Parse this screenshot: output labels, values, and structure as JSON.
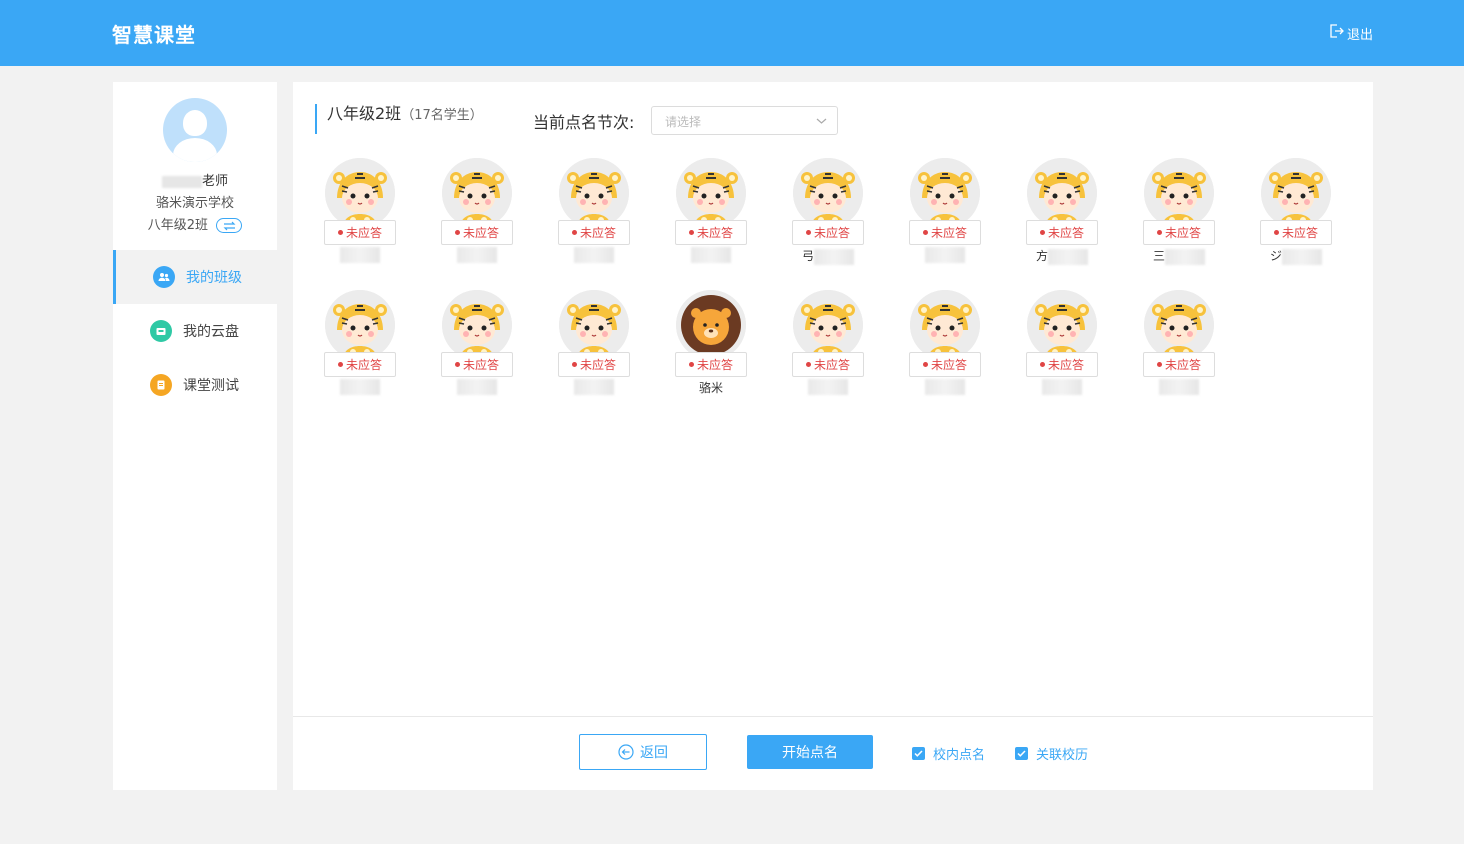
{
  "header": {
    "app_title": "智慧课堂",
    "logout_label": "退出"
  },
  "sidebar": {
    "teacher_suffix": "老师",
    "school": "骆米演示学校",
    "class_name": "八年级2班",
    "items": [
      {
        "label": "我的班级",
        "icon": "users-icon",
        "active": true,
        "color": "#3aa7f5"
      },
      {
        "label": "我的云盘",
        "icon": "cloud-drive-icon",
        "active": false,
        "color": "#2fc9a5"
      },
      {
        "label": "课堂测试",
        "icon": "test-doc-icon",
        "active": false,
        "color": "#f5a623"
      }
    ]
  },
  "main": {
    "class_title": "八年级2班",
    "student_count": "（17名学生）",
    "session_label": "当前点名节次:",
    "session_placeholder": "请选择",
    "status_label": "未应答",
    "students": [
      {
        "name": "",
        "avatar": "tiger"
      },
      {
        "name": "",
        "avatar": "tiger"
      },
      {
        "name": "",
        "avatar": "tiger"
      },
      {
        "name": "",
        "avatar": "tiger"
      },
      {
        "name": "弓",
        "avatar": "tiger"
      },
      {
        "name": "",
        "avatar": "tiger"
      },
      {
        "name": "方",
        "avatar": "tiger"
      },
      {
        "name": "三",
        "avatar": "tiger"
      },
      {
        "name": "ジ",
        "avatar": "tiger"
      },
      {
        "name": "",
        "avatar": "tiger"
      },
      {
        "name": "",
        "avatar": "tiger"
      },
      {
        "name": "",
        "avatar": "tiger"
      },
      {
        "name": "骆米",
        "avatar": "lion"
      },
      {
        "name": "",
        "avatar": "tiger"
      },
      {
        "name": "",
        "avatar": "tiger"
      },
      {
        "name": "",
        "avatar": "tiger"
      },
      {
        "name": "",
        "avatar": "tiger"
      }
    ],
    "back_label": "返回",
    "start_label": "开始点名",
    "check_school": "校内点名",
    "check_calendar": "关联校历"
  },
  "colors": {
    "primary": "#3aa7f5",
    "status_red": "#e04545"
  }
}
